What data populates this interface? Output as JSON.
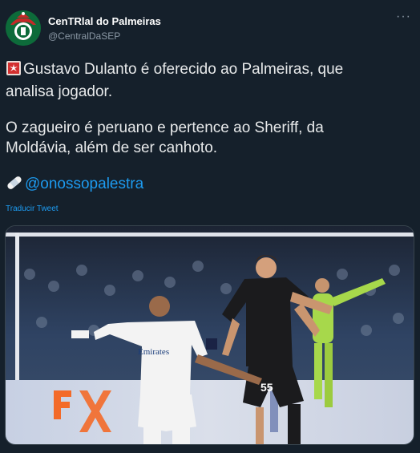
{
  "author": {
    "display_name": "CenTRlal do Palmeiras",
    "handle": "@CentralDaSEP"
  },
  "tweet": {
    "line1": "Gustavo Dulanto é oferecido ao Palmeiras, que",
    "line2": "analisa jogador.",
    "line3": "O zagueiro é peruano e pertence ao Sheriff, da",
    "line4": "Moldávia, além de ser canhoto.",
    "mention": "@onossopalestra",
    "translate": "Traducir Tweet"
  },
  "media": {
    "jersey_text": "Emirates",
    "player_number": "55"
  },
  "colors": {
    "background": "#15202b",
    "link": "#1d9bf0",
    "palmeiras_green": "#0d6b3a"
  },
  "icons": [
    "siren-emoji",
    "bandage-emoji",
    "more-icon"
  ]
}
